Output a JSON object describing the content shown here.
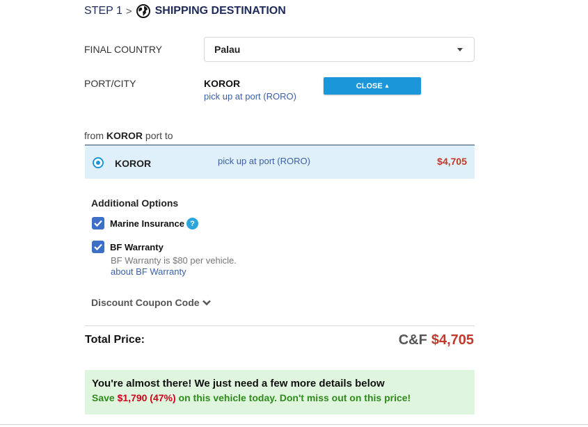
{
  "step": {
    "number": "STEP 1",
    "separator": ">",
    "title": "SHIPPING DESTINATION",
    "icon": "globe-icon"
  },
  "destination": {
    "country_label": "FINAL COUNTRY",
    "country_value": "Palau",
    "port_label": "PORT/CITY",
    "port_name": "KOROR",
    "port_method": "pick up at port (RORO)",
    "close_button": "CLOSE"
  },
  "routes": {
    "from_prefix": "from ",
    "from_port": "KOROR",
    "from_suffix": " port to",
    "items": [
      {
        "name": "KOROR",
        "method": "pick up at port (RORO)",
        "price": "$4,705",
        "selected": true
      }
    ]
  },
  "options": {
    "title": "Additional Options",
    "marine_insurance": {
      "label": "Marine Insurance",
      "checked": true,
      "help": "?"
    },
    "bf_warranty": {
      "label": "BF Warranty",
      "checked": true,
      "note": "BF Warranty is $80 per vehicle.",
      "link": "about BF Warranty"
    },
    "coupon": "Discount Coupon Code"
  },
  "total": {
    "label": "Total Price:",
    "terms": "C&F",
    "amount": "$4,705"
  },
  "promo": {
    "line1": "You're almost there! We just need a few more details below",
    "line2_prefix": "Save ",
    "line2_amount": "$1,790 (47%)",
    "line2_suffix": " on this vehicle today. Don't miss out on this price!"
  },
  "colors": {
    "accent_blue": "#1a96d9",
    "price_red": "#c0392b",
    "row_highlight": "#dff0fb",
    "promo_bg": "#dff5dd",
    "promo_green": "#2e8b1c"
  }
}
